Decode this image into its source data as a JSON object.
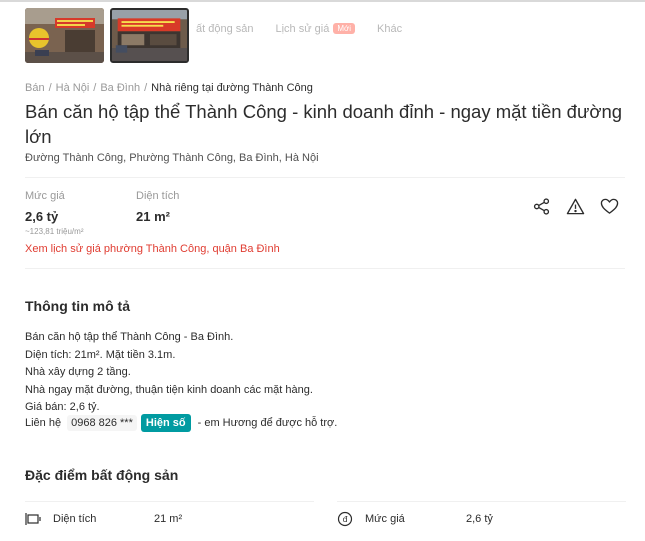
{
  "subnav": {
    "items": [
      {
        "label": "Lịch sử giá",
        "badge": "Mới"
      },
      {
        "label": "Khác"
      }
    ],
    "partial_item": "ất động sản"
  },
  "breadcrumb": {
    "items": [
      "Bán",
      "Hà Nội",
      "Ba Đình"
    ],
    "current": "Nhà riêng tại đường Thành Công",
    "separator": "/"
  },
  "listing": {
    "title": "Bán căn hộ tập thể Thành Công - kinh doanh đỉnh - ngay mặt tiền đường lớn",
    "address": "Đường Thành Công, Phường Thành Công, Ba Đình, Hà Nội"
  },
  "stats": {
    "price_label": "Mức giá",
    "price_value": "2,6 tỷ",
    "price_per_m2": "~123,81 triệu/m²",
    "area_label": "Diện tích",
    "area_value": "21 m²"
  },
  "actions": [
    {
      "icon": "share-icon"
    },
    {
      "icon": "report-icon"
    },
    {
      "icon": "heart-icon"
    }
  ],
  "history_link": "Xem lịch sử giá phường Thành Công, quận Ba Đình",
  "description": {
    "heading": "Thông tin mô tả",
    "lines": [
      "Bán căn hộ tập thể Thành Công - Ba Đình.",
      "Diện tích: 21m². Mặt tiền 3.1m.",
      "Nhà xây dựng 2 tầng.",
      "Nhà ngay mặt đường, thuận tiện kinh doanh các mặt hàng.",
      "Giá bán: 2,6 tỷ."
    ],
    "contact_prefix": "Liên hệ",
    "phone_masked": "0968 826 ***",
    "reveal_label": "Hiện số",
    "contact_suffix": "- em Hương để được hỗ trợ."
  },
  "features": {
    "heading": "Đặc điểm bất động sản",
    "rows": [
      {
        "icon": "area-icon",
        "key": "Diện tích",
        "value": "21 m²"
      },
      {
        "icon": "price-icon",
        "key": "Mức giá",
        "value": "2,6 tỷ"
      }
    ]
  },
  "colors": {
    "accent_red": "#e03c31",
    "reveal_teal": "#009ba1",
    "badge_pink": "#ffb1a8"
  }
}
